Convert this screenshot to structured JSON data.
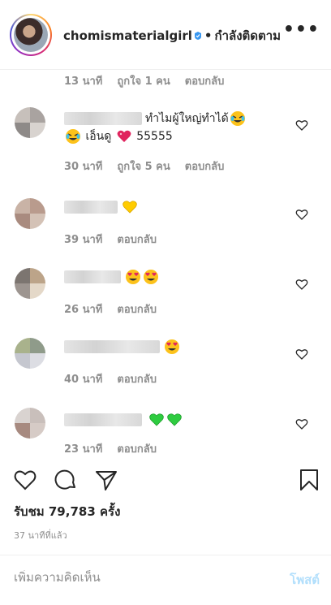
{
  "header": {
    "username": "chomismaterialgirl",
    "verified_icon": "verified-badge-icon",
    "separator": "•",
    "follow_status": "กำลังติดตาม",
    "more_icon": "more-options-icon",
    "more_label": "•••"
  },
  "top_comment_meta": {
    "time": "13 นาที",
    "likes": "ถูกใจ 1 คน",
    "reply": "ตอบกลับ"
  },
  "comments": [
    {
      "text_line1": "ทำไมผู้ใหญ่ทำได้",
      "text_line2": "เอ็นดู",
      "text_line2_suffix": "55555",
      "time": "30 นาที",
      "likes": "ถูกใจ 5 คน",
      "reply": "ตอบกลับ"
    },
    {
      "text": "",
      "time": "39 นาที",
      "reply": "ตอบกลับ"
    },
    {
      "text": "",
      "time": "26 นาที",
      "reply": "ตอบกลับ"
    },
    {
      "text": "",
      "time": "40 นาที",
      "reply": "ตอบกลับ"
    },
    {
      "text": "",
      "time": "23 นาที",
      "reply": "ตอบกลับ"
    }
  ],
  "actions": {
    "like_icon": "heart-icon",
    "comment_icon": "comment-icon",
    "share_icon": "send-icon",
    "save_icon": "bookmark-icon"
  },
  "views": "รับชม 79,783 ครั้ง",
  "posted_ago": "37 นาทีที่แล้ว",
  "add_comment": {
    "placeholder": "เพิ่มความคิดเห็น",
    "post_label": "โพสต์"
  },
  "colors": {
    "text": "#262626",
    "muted": "#8e8e8e",
    "post_disabled": "#b2dffc",
    "border": "#efefef"
  }
}
